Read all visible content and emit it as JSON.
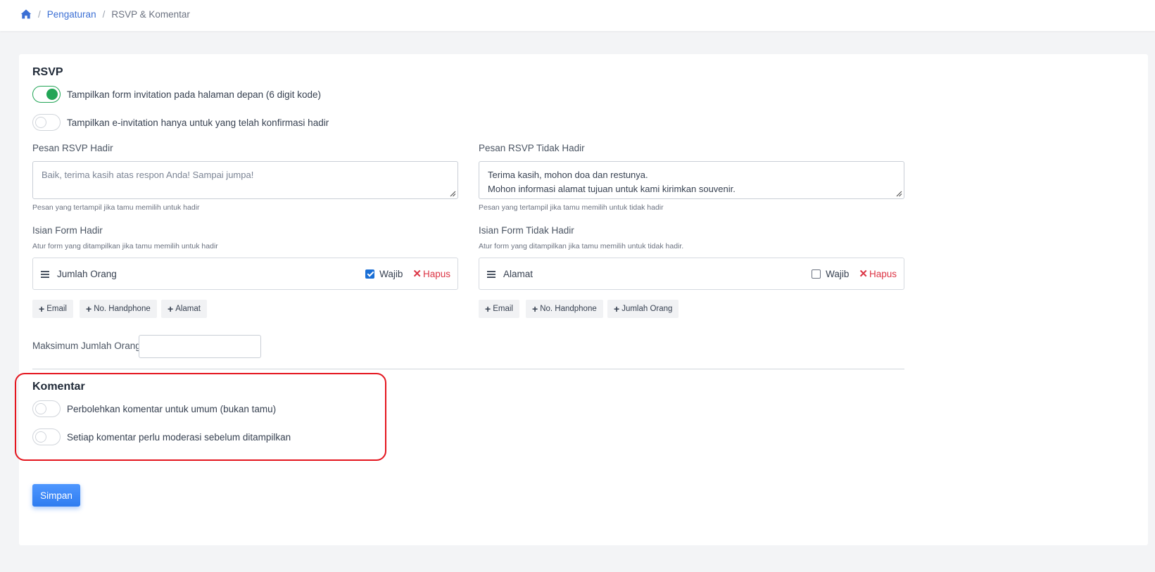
{
  "breadcrumb": {
    "home_icon": "home-icon",
    "items": [
      "Pengaturan",
      "RSVP & Komentar"
    ],
    "separator": "/"
  },
  "rsvp": {
    "title": "RSVP",
    "toggles": [
      {
        "label": "Tampilkan form invitation pada halaman depan (6 digit kode)",
        "on": true
      },
      {
        "label": "Tampilkan e-invitation hanya untuk yang telah konfirmasi hadir",
        "on": false
      }
    ],
    "hadir": {
      "message_label": "Pesan RSVP Hadir",
      "message_value": "",
      "message_placeholder": "Baik, terima kasih atas respon Anda! Sampai jumpa!",
      "message_helper": "Pesan yang tertampil jika tamu memilih untuk hadir",
      "form_label": "Isian Form Hadir",
      "form_helper": "Atur form yang ditampilkan jika tamu memilih untuk hadir",
      "fields": [
        {
          "label": "Jumlah Orang",
          "required": true,
          "required_label": "Wajib",
          "delete_label": "Hapus"
        }
      ],
      "add_buttons": [
        "Email",
        "No. Handphone",
        "Alamat"
      ]
    },
    "tidak_hadir": {
      "message_label": "Pesan RSVP Tidak Hadir",
      "message_lines": [
        "Terima kasih, mohon doa dan restunya.",
        "Mohon informasi alamat tujuan untuk kami kirimkan souvenir."
      ],
      "message_helper": "Pesan yang tertampil jika tamu memilih untuk tidak hadir",
      "form_label": "Isian Form Tidak Hadir",
      "form_helper": "Atur form yang ditampilkan jika tamu memilih untuk tidak hadir.",
      "fields": [
        {
          "label": "Alamat",
          "required": false,
          "required_label": "Wajib",
          "delete_label": "Hapus"
        }
      ],
      "add_buttons": [
        "Email",
        "No. Handphone",
        "Jumlah Orang"
      ]
    },
    "max_label": "Maksimum Jumlah Orang",
    "max_value": ""
  },
  "komentar": {
    "title": "Komentar",
    "toggles": [
      {
        "label": "Perbolehkan komentar untuk umum (bukan tamu)",
        "on": false
      },
      {
        "label": "Setiap komentar perlu moderasi sebelum ditampilkan",
        "on": false
      }
    ]
  },
  "save_label": "Simpan",
  "colors": {
    "primary": "#2f7cf0",
    "toggle_on": "#22a556",
    "danger": "#dc3545",
    "link": "#3b6fd4",
    "highlight": "#e4151e"
  }
}
